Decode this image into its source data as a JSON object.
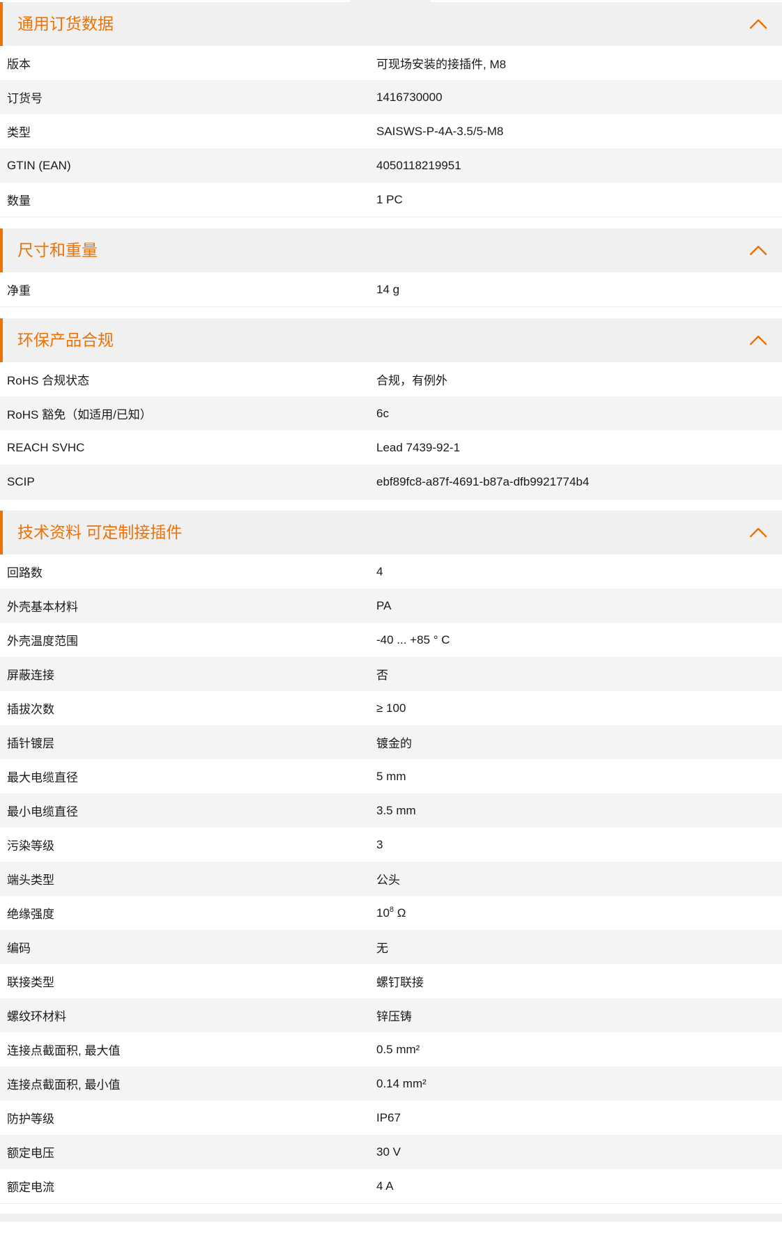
{
  "accent_color": "#ee7203",
  "sections": [
    {
      "title": "通用订货数据",
      "icon": "chevron-up-icon",
      "rows": [
        {
          "label": "版本",
          "value": "可现场安装的接插件, M8"
        },
        {
          "label": "订货号",
          "value": "1416730000"
        },
        {
          "label": "类型",
          "value": "SAISWS-P-4A-3.5/5-M8"
        },
        {
          "label": "GTIN (EAN)",
          "value": "4050118219951"
        },
        {
          "label": "数量",
          "value": "1  PC"
        }
      ]
    },
    {
      "title": "尺寸和重量",
      "icon": "chevron-up-icon",
      "rows": [
        {
          "label": "净重",
          "value": "14  g"
        }
      ]
    },
    {
      "title": "环保产品合规",
      "icon": "chevron-up-icon",
      "rows": [
        {
          "label": "RoHS 合规状态",
          "value": "合规，有例外"
        },
        {
          "label": "RoHS 豁免（如适用/已知）",
          "value": "6c"
        },
        {
          "label": "REACH SVHC",
          "value": "Lead 7439-92-1"
        },
        {
          "label": "SCIP",
          "value": "ebf89fc8-a87f-4691-b87a-dfb9921774b4"
        }
      ]
    },
    {
      "title": "技术资料 可定制接插件",
      "icon": "chevron-up-icon",
      "rows": [
        {
          "label": "回路数",
          "value": "4"
        },
        {
          "label": "外壳基本材料",
          "value": "PA"
        },
        {
          "label": "外壳温度范围",
          "value": "-40 ... +85 ° C"
        },
        {
          "label": "屏蔽连接",
          "value": "否"
        },
        {
          "label": "插拔次数",
          "value": "≥ 100"
        },
        {
          "label": "插针镀层",
          "value": "镀金的"
        },
        {
          "label": "最大电缆直径",
          "value": "5  mm"
        },
        {
          "label": "最小电缆直径",
          "value": "3.5  mm"
        },
        {
          "label": "污染等级",
          "value": "3"
        },
        {
          "label": "端头类型",
          "value": "公头"
        },
        {
          "label": "绝缘强度",
          "value": "10",
          "value_sup": "8",
          "value_unit": " Ω"
        },
        {
          "label": "编码",
          "value": "无"
        },
        {
          "label": "联接类型",
          "value": "螺钉联接"
        },
        {
          "label": "螺纹环材料",
          "value": "锌压铸"
        },
        {
          "label": "连接点截面积, 最大值",
          "value": "0.5  mm²"
        },
        {
          "label": "连接点截面积, 最小值",
          "value": "0.14  mm²"
        },
        {
          "label": "防护等级",
          "value": "IP67"
        },
        {
          "label": "额定电压",
          "value": "30  V"
        },
        {
          "label": "额定电流",
          "value": "4  A"
        }
      ]
    }
  ]
}
